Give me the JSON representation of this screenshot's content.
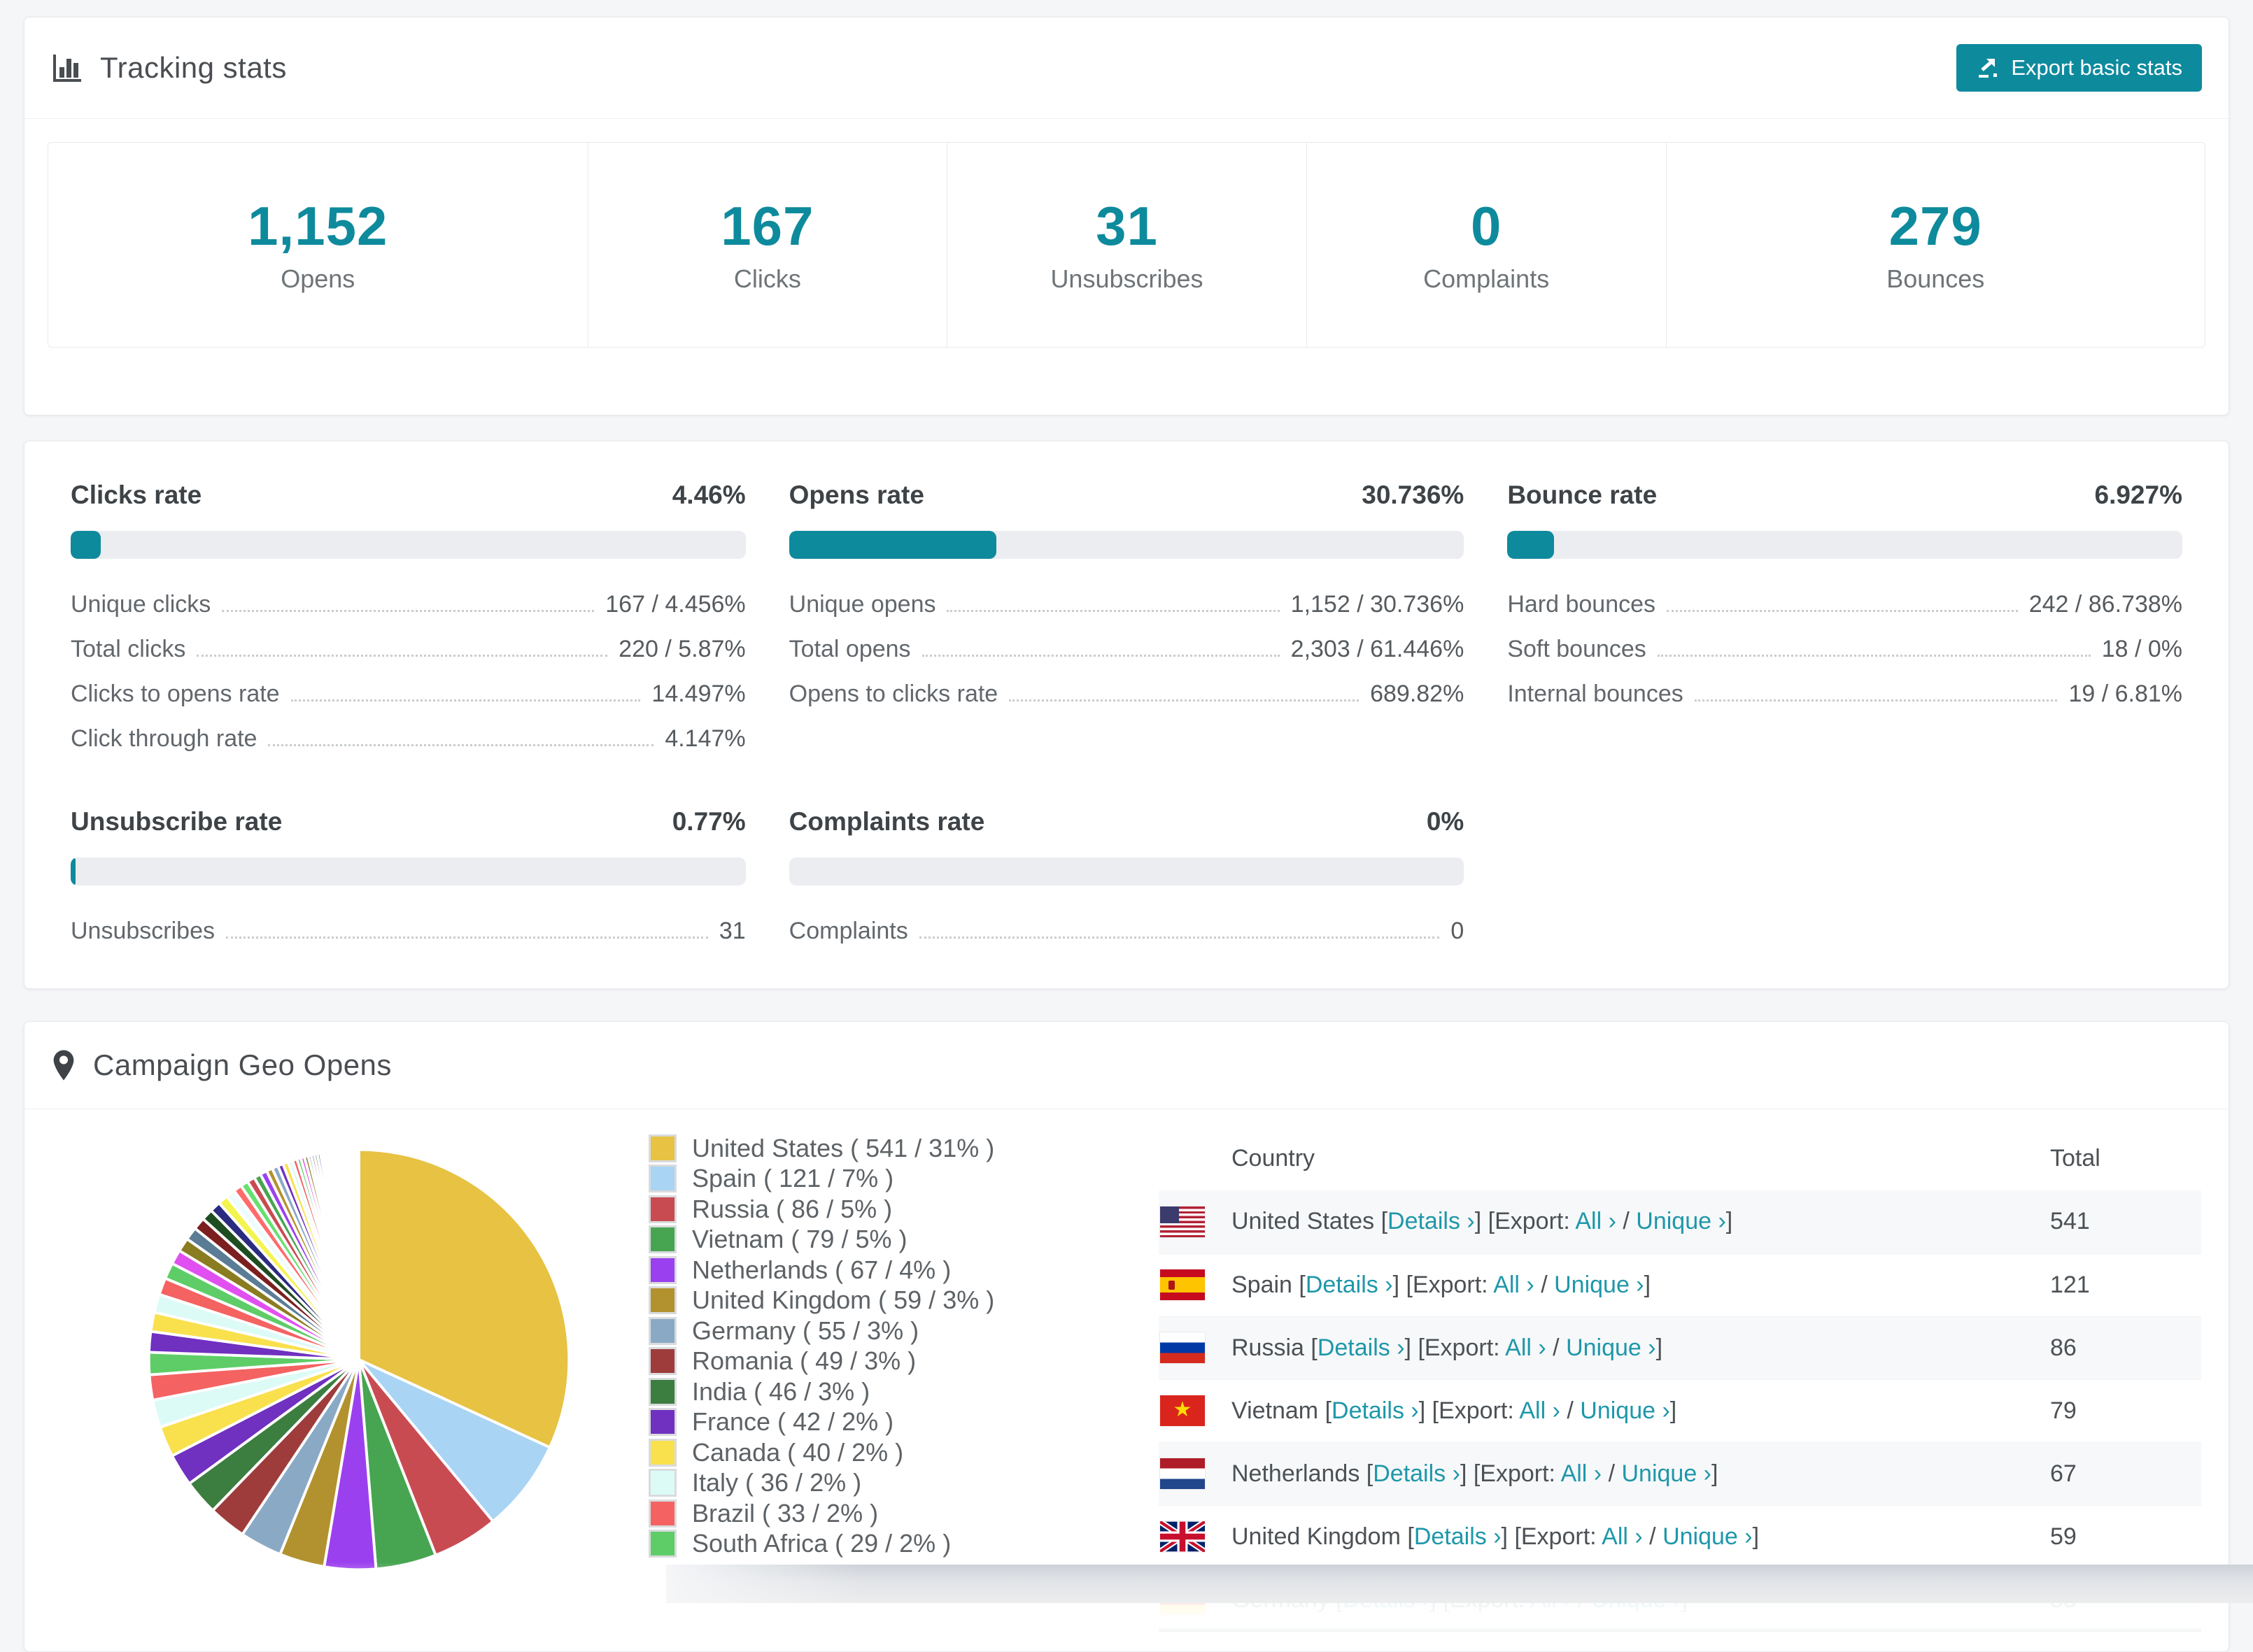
{
  "colors": {
    "accent_teal": "#0e8a9d",
    "link_teal": "#1e97aa",
    "progress_track": "#ecedf0"
  },
  "tracking": {
    "icon": "bar-chart-icon",
    "title": "Tracking stats",
    "export_button": "Export basic stats",
    "export_button_icon": "export-icon",
    "stats": [
      {
        "value": "1,152",
        "label": "Opens"
      },
      {
        "value": "167",
        "label": "Clicks"
      },
      {
        "value": "31",
        "label": "Unsubscribes"
      },
      {
        "value": "0",
        "label": "Complaints"
      },
      {
        "value": "279",
        "label": "Bounces"
      }
    ]
  },
  "rates": {
    "panels": [
      {
        "title": "Clicks rate",
        "pct_label": "4.46%",
        "pct": 4.46,
        "rows": [
          [
            "Unique clicks",
            "167 / 4.456%"
          ],
          [
            "Total clicks",
            "220 / 5.87%"
          ],
          [
            "Clicks to opens rate",
            "14.497%"
          ],
          [
            "Click through rate",
            "4.147%"
          ]
        ]
      },
      {
        "title": "Opens rate",
        "pct_label": "30.736%",
        "pct": 30.736,
        "rows": [
          [
            "Unique opens",
            "1,152 / 30.736%"
          ],
          [
            "Total opens",
            "2,303 / 61.446%"
          ],
          [
            "Opens to clicks rate",
            "689.82%"
          ]
        ]
      },
      {
        "title": "Bounce rate",
        "pct_label": "6.927%",
        "pct": 6.927,
        "rows": [
          [
            "Hard bounces",
            "242 / 86.738%"
          ],
          [
            "Soft bounces",
            "18 / 0%"
          ],
          [
            "Internal bounces",
            "19 / 6.81%"
          ]
        ]
      },
      {
        "title": "Unsubscribe rate",
        "pct_label": "0.77%",
        "pct": 0.77,
        "rows": [
          [
            "Unsubscribes",
            "31"
          ]
        ]
      },
      {
        "title": "Complaints rate",
        "pct_label": "0%",
        "pct": 0,
        "rows": [
          [
            "Complaints",
            "0"
          ]
        ]
      }
    ]
  },
  "geo": {
    "icon": "map-pin-icon",
    "title": "Campaign Geo Opens",
    "table": {
      "country_header": "Country",
      "total_header": "Total",
      "link_details": "Details ›",
      "link_all": "All ›",
      "link_unique": "Unique ›",
      "bracket_open": "[",
      "bracket_close": "]",
      "export_prefix": "[Export:",
      "separator": "/",
      "rows": [
        {
          "country": "United States",
          "flag": "us",
          "total": "541"
        },
        {
          "country": "Spain",
          "flag": "es",
          "total": "121"
        },
        {
          "country": "Russia",
          "flag": "ru",
          "total": "86"
        },
        {
          "country": "Vietnam",
          "flag": "vn",
          "total": "79"
        },
        {
          "country": "Netherlands",
          "flag": "nl",
          "total": "67"
        },
        {
          "country": "United Kingdom",
          "flag": "gb",
          "total": "59"
        },
        {
          "country": "Germany",
          "flag": "de",
          "total": "55",
          "partial": true
        }
      ]
    }
  },
  "chart_data": {
    "type": "pie",
    "title": "Campaign Geo Opens",
    "legend_position": "right-of-pie",
    "start_angle_deg": -90,
    "clockwise": true,
    "categories": [
      "United States",
      "Spain",
      "Russia",
      "Vietnam",
      "Netherlands",
      "United Kingdom",
      "Germany",
      "Romania",
      "India",
      "France",
      "Canada",
      "Italy",
      "Brazil",
      "South Africa"
    ],
    "values": [
      541,
      121,
      86,
      79,
      67,
      59,
      55,
      49,
      46,
      42,
      40,
      36,
      33,
      29
    ],
    "pcts": [
      "31%",
      "7%",
      "5%",
      "5%",
      "4%",
      "3%",
      "3%",
      "3%",
      "3%",
      "2%",
      "2%",
      "2%",
      "2%",
      "2%"
    ],
    "colors": [
      "#e7c243",
      "#a9d4f4",
      "#c94b52",
      "#47a551",
      "#9b40ee",
      "#b2922e",
      "#8aa9c5",
      "#9e3c3c",
      "#3c7d40",
      "#7030c0",
      "#f9e04d",
      "#dcfbf7",
      "#f46262",
      "#5ecd67"
    ],
    "others_values": [
      27,
      25,
      24,
      22,
      21,
      19,
      18,
      17,
      16,
      15,
      14,
      13,
      12,
      11,
      10,
      10,
      9,
      9,
      8,
      8,
      7,
      7,
      6,
      6,
      5,
      5,
      5,
      4,
      4,
      4,
      4,
      3,
      3,
      3,
      3,
      3,
      3,
      2,
      2,
      2,
      2,
      2,
      2,
      2,
      2,
      2,
      1,
      1,
      1,
      1,
      1,
      1,
      1,
      1,
      1,
      1,
      1,
      1,
      1,
      1
    ],
    "others_colors": [
      "#7030c0",
      "#f9e04d",
      "#dcfbf7",
      "#f46262",
      "#5ecd67",
      "#e050f0",
      "#8a7c20",
      "#5b7c95",
      "#7c1f1f",
      "#1f4d22",
      "#2b2b80",
      "#f4f44e",
      "#eefcff",
      "#ff6b6b",
      "#66e06e",
      "#c94b52",
      "#47a551",
      "#9b40ee",
      "#b2922e",
      "#8aa9c5"
    ]
  }
}
